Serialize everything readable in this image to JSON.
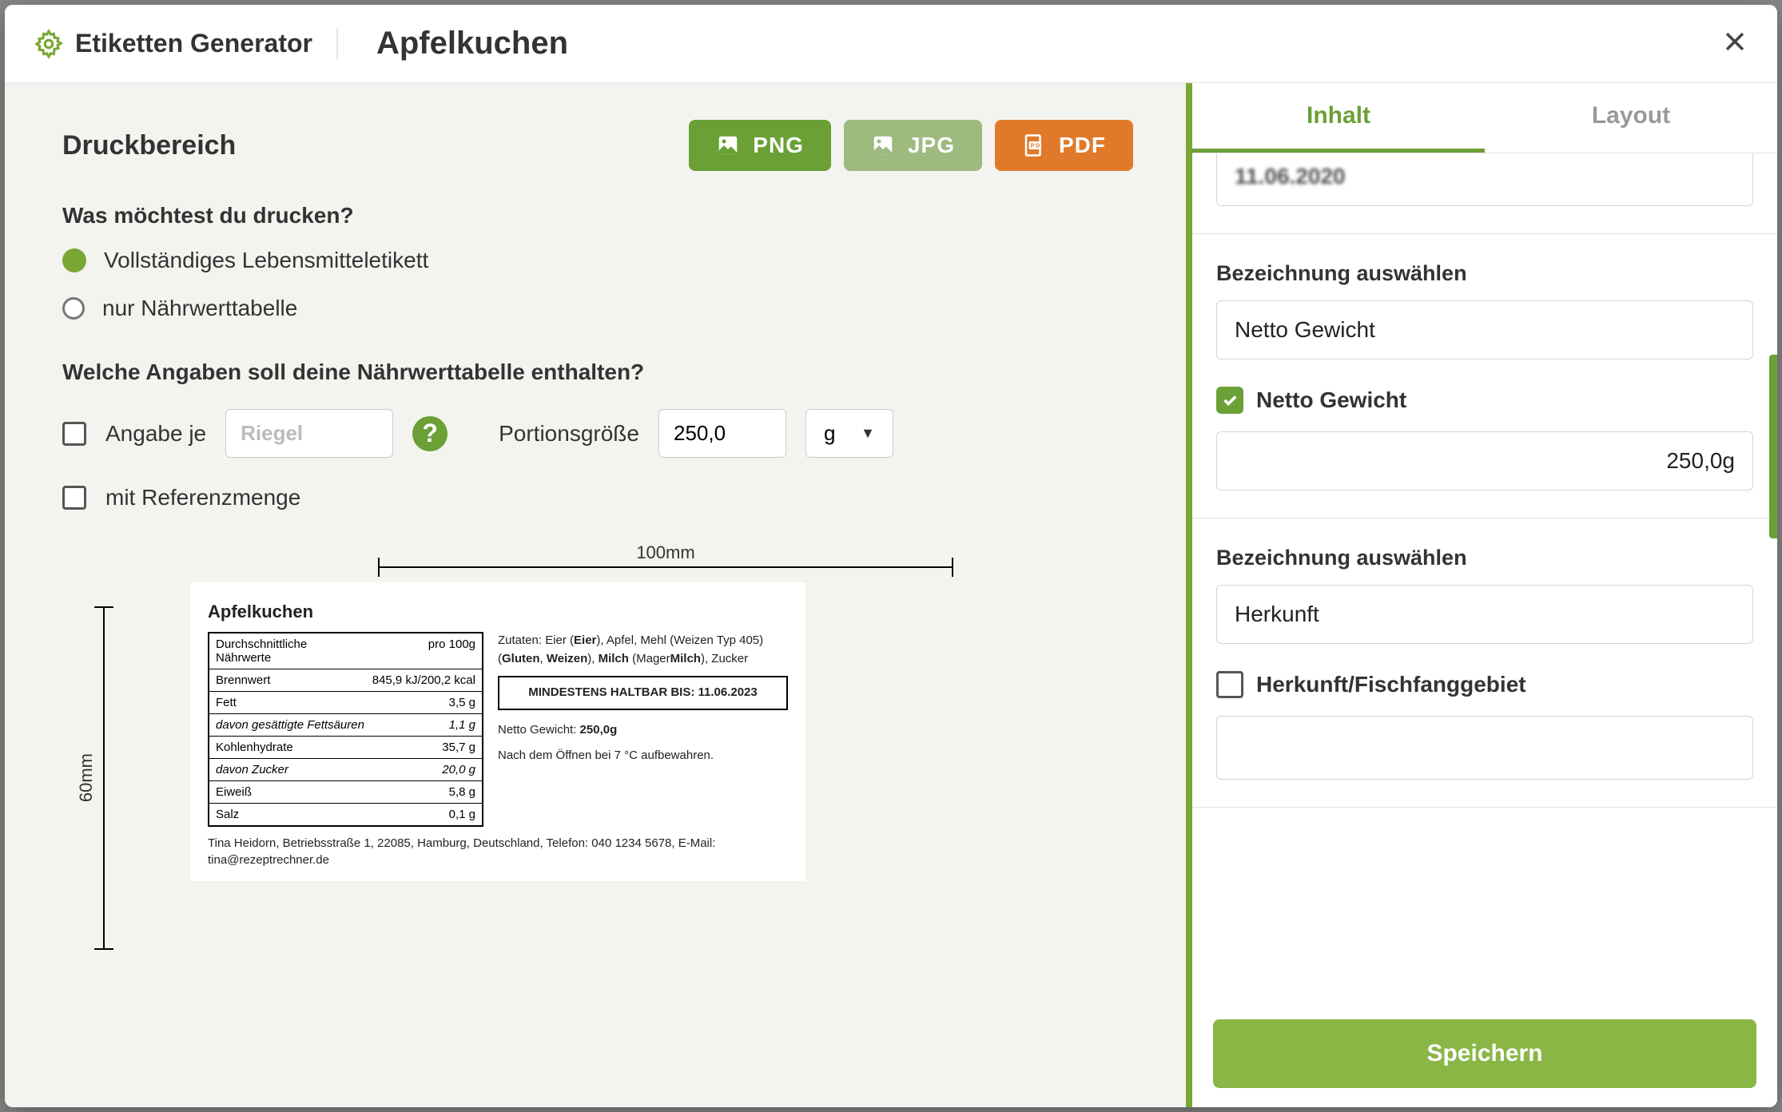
{
  "header": {
    "brand": "Etiketten Generator",
    "recipe": "Apfelkuchen"
  },
  "left": {
    "title": "Druckbereich",
    "export": {
      "png": "PNG",
      "jpg": "JPG",
      "pdf": "PDF"
    },
    "q1": "Was möchtest du drucken?",
    "opt_full": "Vollständiges Lebensmitteletikett",
    "opt_nutri_only": "nur Nährwerttabelle",
    "q2": "Welche Angaben soll deine Nährwerttabelle enthalten?",
    "per_label": "Angabe je",
    "per_placeholder": "Riegel",
    "portion_label": "Portionsgröße",
    "portion_value": "250,0",
    "unit_value": "g",
    "ref_label": "mit Referenzmenge",
    "ruler_h": "100mm",
    "ruler_v": "60mm"
  },
  "preview": {
    "title": "Apfelkuchen",
    "col_header_label": "Durchschnittliche Nährwerte",
    "col_header_val": "pro 100g",
    "rows": {
      "brennwert_l": "Brennwert",
      "brennwert_v": "845,9 kJ/200,2 kcal",
      "fett_l": "Fett",
      "fett_v": "3,5 g",
      "satfat_l": "davon gesättigte Fettsäuren",
      "satfat_v": "1,1 g",
      "kh_l": "Kohlenhydrate",
      "kh_v": "35,7 g",
      "zucker_l": "davon Zucker",
      "zucker_v": "20,0 g",
      "eiweiss_l": "Eiweiß",
      "eiweiss_v": "5,8 g",
      "salz_l": "Salz",
      "salz_v": "0,1 g"
    },
    "ingredients_html": "Zutaten: Eier (<b>Eier</b>), Apfel, Mehl (Weizen Typ 405) (<b>Gluten</b>, <b>Weizen</b>), <b>Milch</b> (Mager<b>Milch</b>), Zucker",
    "mhd": "MINDESTENS HALTBAR BIS: 11.06.2023",
    "netto_label": "Netto Gewicht:",
    "netto_value": "250,0g",
    "storage": "Nach dem Öffnen bei 7 °C aufbewahren.",
    "contact": "Tina Heidorn, Betriebsstraße 1, 22085, Hamburg, Deutschland, Telefon: 040 1234 5678, E-Mail: tina@rezeptrechner.de"
  },
  "right": {
    "tab_content": "Inhalt",
    "tab_layout": "Layout",
    "partial_date": "11.06.2020",
    "label_select1": "Bezeichnung auswählen",
    "value_select1": "Netto Gewicht",
    "check_netto": "Netto Gewicht",
    "netto_value": "250,0g",
    "label_select2": "Bezeichnung auswählen",
    "value_select2": "Herkunft",
    "check_herkunft": "Herkunft/Fischfanggebiet",
    "herkunft_value": "",
    "save": "Speichern"
  }
}
